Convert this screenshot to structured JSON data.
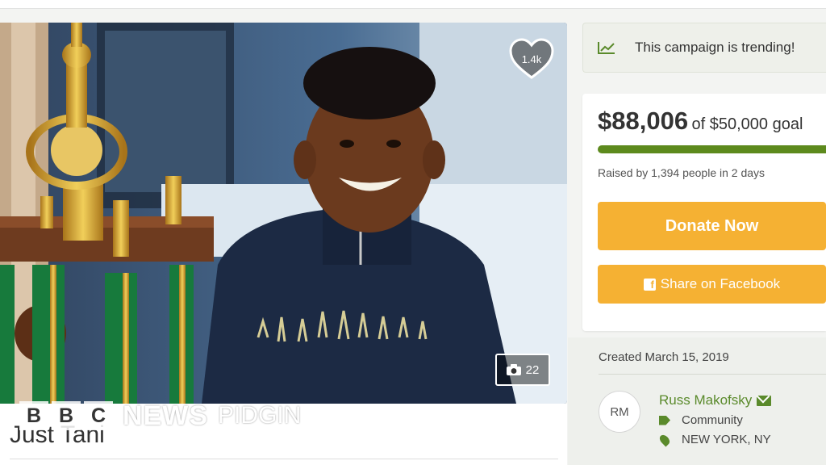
{
  "hero": {
    "likes": "1.4k",
    "photo_count": "22",
    "watermark": {
      "brand": "BBC",
      "letters": [
        "B",
        "B",
        "C"
      ],
      "news": "NEWS",
      "service": "PIDGIN"
    }
  },
  "campaign": {
    "title": "Just Tani"
  },
  "trending": {
    "label": "This campaign is trending!"
  },
  "donation": {
    "raised": "$88,006",
    "goal_text": "of $50,000 goal",
    "progress_fraction": 1.0,
    "raised_by": "Raised by 1,394 people in 2 days",
    "donate_label": "Donate Now",
    "share_label": "Share on Facebook"
  },
  "details": {
    "created": "Created March 15, 2019",
    "avatar_initials": "RM",
    "organizer": "Russ Makofsky",
    "category": "Community",
    "location": "NEW YORK, NY"
  },
  "colors": {
    "accent_orange": "#f5b133",
    "accent_green": "#5a8a2b",
    "progress_green": "#5d8a1d"
  },
  "icons": [
    "heart-icon",
    "camera-icon",
    "trending-chart-icon",
    "facebook-icon",
    "mail-icon",
    "tag-icon",
    "location-pin-icon"
  ]
}
